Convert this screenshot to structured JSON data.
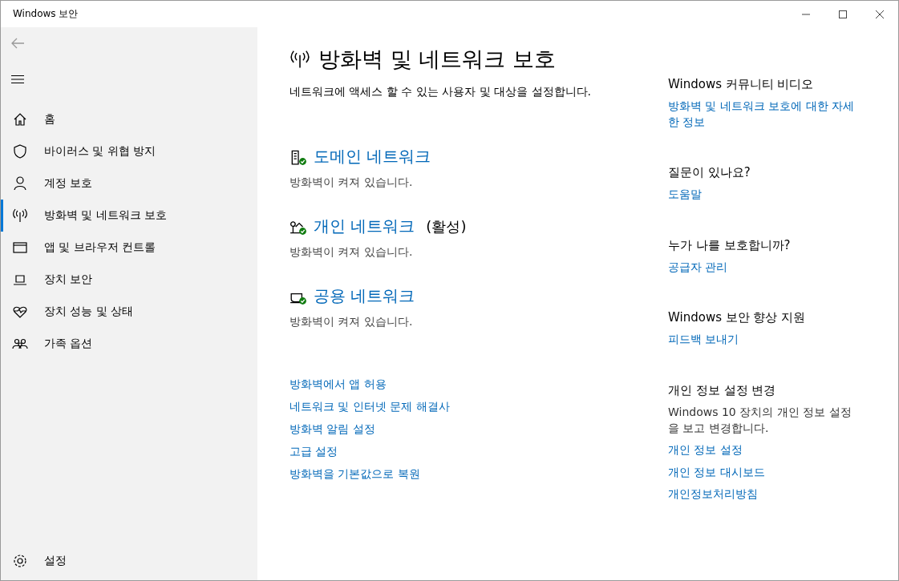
{
  "window": {
    "title": "Windows 보안"
  },
  "sidebar": {
    "items": [
      {
        "kind": "home",
        "label": "홈",
        "selected": false
      },
      {
        "kind": "shield",
        "label": "바이러스 및 위협 방지",
        "selected": false
      },
      {
        "kind": "person",
        "label": "계정 보호",
        "selected": false
      },
      {
        "kind": "antenna",
        "label": "방화벽 및 네트워크 보호",
        "selected": true
      },
      {
        "kind": "browser",
        "label": "앱 및 브라우저 컨트롤",
        "selected": false
      },
      {
        "kind": "laptop",
        "label": "장치 보안",
        "selected": false
      },
      {
        "kind": "heart",
        "label": "장치 성능 및 상태",
        "selected": false
      },
      {
        "kind": "family",
        "label": "가족 옵션",
        "selected": false
      }
    ],
    "settings": {
      "label": "설정"
    }
  },
  "page": {
    "title": "방화벽 및 네트워크 보호",
    "subtitle": "네트워크에 액세스 할 수 있는 사용자 및 대상을 설정합니다.",
    "networks": [
      {
        "kind": "domain",
        "name": "도메인 네트워크",
        "status": "방화벽이 켜져 있습니다."
      },
      {
        "kind": "private",
        "name": "개인 네트워크",
        "active_label": "(활성)",
        "status": "방화벽이 켜져 있습니다."
      },
      {
        "kind": "public",
        "name": "공용 네트워크",
        "status": "방화벽이 켜져 있습니다."
      }
    ],
    "links": [
      "방화벽에서 앱 허용",
      "네트워크 및 인터넷 문제 해결사",
      "방화벽 알림 설정",
      "고급 설정",
      "방화벽을 기본값으로 복원"
    ]
  },
  "aside": [
    {
      "heading": "Windows 커뮤니티 비디오",
      "links": [
        "방화벽 및 네트워크 보호에 대한 자세한 정보"
      ]
    },
    {
      "heading": "질문이 있나요?",
      "links": [
        "도움말"
      ]
    },
    {
      "heading": "누가 나를 보호합니까?",
      "links": [
        "공급자 관리"
      ]
    },
    {
      "heading": "Windows 보안 향상 지원",
      "links": [
        "피드백 보내기"
      ]
    },
    {
      "heading": "개인 정보 설정 변경",
      "text": "Windows 10 장치의 개인 정보 설정을 보고 변경합니다.",
      "links": [
        "개인 정보 설정",
        "개인 정보 대시보드",
        "개인정보처리방침"
      ]
    }
  ]
}
